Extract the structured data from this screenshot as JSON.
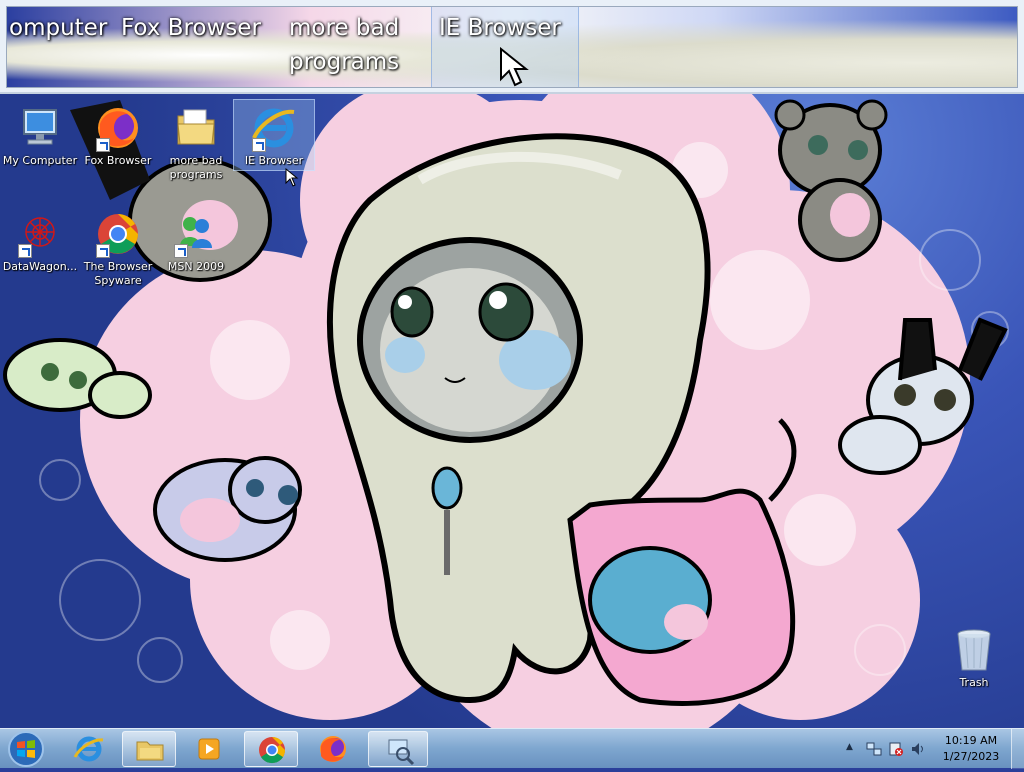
{
  "magnifier": {
    "labels": [
      "omputer",
      "Fox Browser",
      "more bad",
      "programs",
      "IE Browser"
    ]
  },
  "desktop": {
    "icons": [
      {
        "label": "My Computer",
        "icon": "computer-icon"
      },
      {
        "label": "Fox Browser",
        "icon": "firefox-icon"
      },
      {
        "label": "more bad programs",
        "icon": "folder-icon"
      },
      {
        "label": "IE Browser",
        "icon": "internet-explorer-icon"
      },
      {
        "label": "DataWagon...",
        "icon": "datawagon-icon"
      },
      {
        "label": "The Browser Spyware",
        "icon": "chrome-icon"
      },
      {
        "label": "MSN 2009",
        "icon": "msn-icon"
      },
      {
        "label": "Trash",
        "icon": "recycle-bin-icon"
      }
    ]
  },
  "taskbar": {
    "pinned": [
      "internet-explorer-icon",
      "file-explorer-icon",
      "media-player-icon",
      "chrome-icon",
      "firefox-icon",
      "magnifier-icon"
    ],
    "clock": {
      "time": "10:19 AM",
      "date": "1/27/2023"
    },
    "tray_icons": [
      "show-hidden-icons-arrow",
      "network-icon",
      "action-center-icon",
      "volume-icon"
    ]
  },
  "colors": {
    "taskbar": "#7ea6cf",
    "wallpaper_blue": "#3a55b8",
    "wallpaper_pink": "#f3c6dc"
  }
}
